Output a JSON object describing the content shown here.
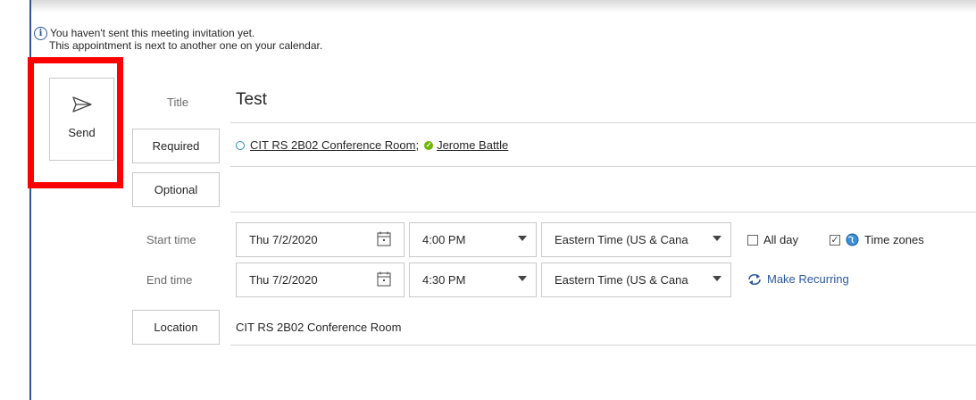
{
  "info": {
    "line1": "You haven't sent this meeting invitation yet.",
    "line2": "This appointment is next to another one on your calendar."
  },
  "send": {
    "label": "Send"
  },
  "title": {
    "label": "Title",
    "value": "Test"
  },
  "required": {
    "label": "Required",
    "attendees": [
      "CIT RS 2B02 Conference Room;",
      "Jerome Battle"
    ]
  },
  "optional": {
    "label": "Optional"
  },
  "start": {
    "label": "Start time",
    "date": "Thu 7/2/2020",
    "time": "4:00 PM",
    "timezone": "Eastern Time (US & Cana"
  },
  "end": {
    "label": "End time",
    "date": "Thu 7/2/2020",
    "time": "4:30 PM",
    "timezone": "Eastern Time (US & Cana"
  },
  "options": {
    "all_day": "All day",
    "all_day_checked": false,
    "time_zones": "Time zones",
    "time_zones_checked": true,
    "make_recurring": "Make Recurring"
  },
  "location": {
    "label": "Location",
    "value": "CIT RS 2B02 Conference Room"
  },
  "colors": {
    "accent": "#2b579a",
    "highlight": "#ff0000",
    "presence_ok": "#6bb700"
  }
}
